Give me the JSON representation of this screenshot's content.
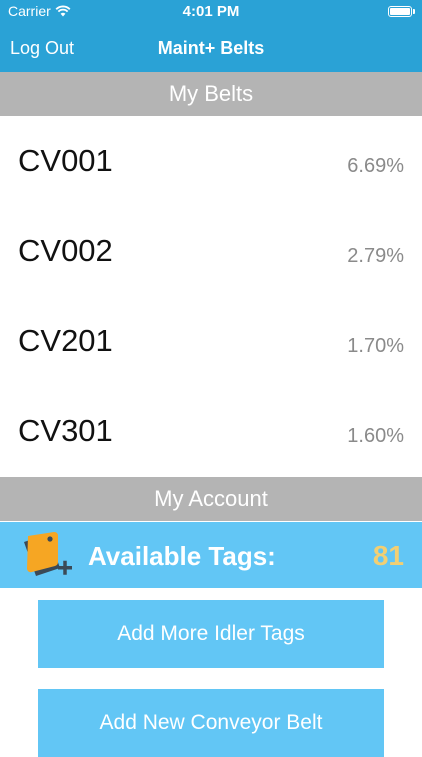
{
  "status_bar": {
    "carrier": "Carrier",
    "time": "4:01 PM"
  },
  "nav": {
    "left_label": "Log Out",
    "title": "Maint+ Belts"
  },
  "my_belts": {
    "header": "My Belts",
    "items": [
      {
        "name": "CV001",
        "percent": "6.69%"
      },
      {
        "name": "CV002",
        "percent": "2.79%"
      },
      {
        "name": "CV201",
        "percent": "1.70%"
      },
      {
        "name": "CV301",
        "percent": "1.60%"
      }
    ]
  },
  "my_account": {
    "header": "My Account",
    "tags_label": "Available Tags:",
    "tags_count": "81",
    "tag_icon": "tag-add-icon",
    "buttons": {
      "add_tags": "Add More Idler Tags",
      "add_belt": "Add New Conveyor Belt"
    }
  },
  "colors": {
    "nav_bar": "#2aa2d6",
    "section_header": "#b4b4b4",
    "accent_light_blue": "#62c6f5",
    "tag_count": "#f2cf73",
    "tag_icon_orange": "#f6a623",
    "tag_icon_dark": "#3b4a57"
  }
}
